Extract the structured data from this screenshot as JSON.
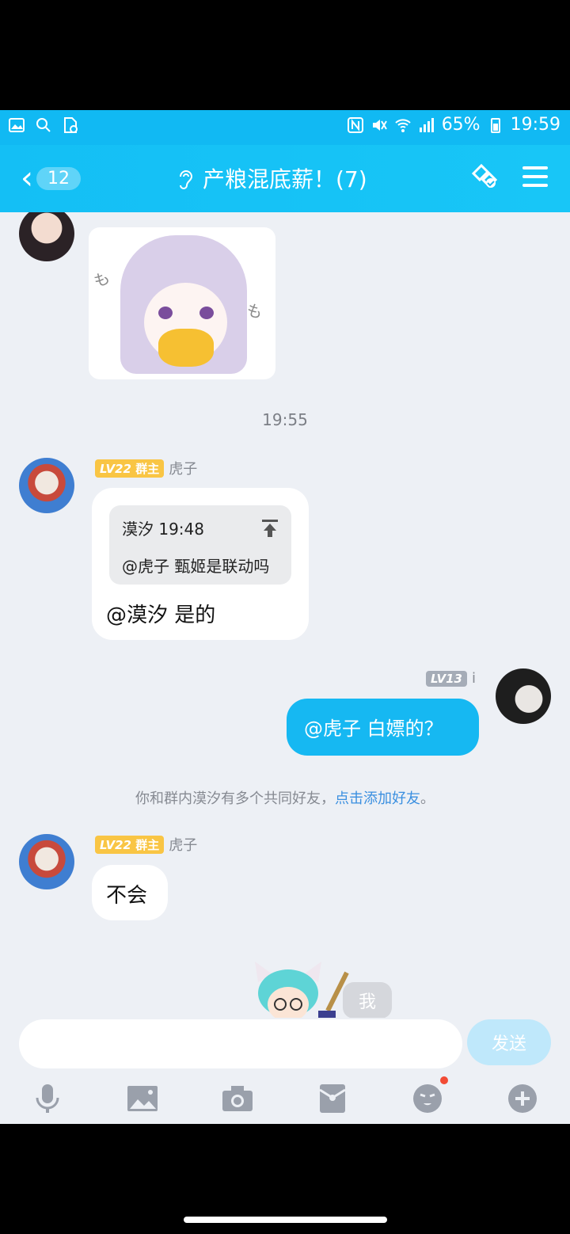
{
  "status_bar": {
    "battery": "65%",
    "time": "19:59"
  },
  "header": {
    "back_badge": "12",
    "title": "产粮混底薪！(7)"
  },
  "chat": {
    "timestamp": "19:55",
    "messages": [
      {
        "level": "LV22",
        "role": "群主",
        "sender": "虎子",
        "quote_header_name": "漠汐",
        "quote_header_time": "19:48",
        "quote_text": "@虎子 甄姬是联动吗",
        "text": "@漠汐 是的"
      },
      {
        "level": "LV13",
        "sender": "i",
        "text": "@虎子 白嫖的？"
      },
      {
        "level": "LV22",
        "role": "群主",
        "sender": "虎子",
        "text": "不会"
      }
    ],
    "notice_text": "你和群内漠汐有多个共同好友，",
    "notice_link": "点击添加好友",
    "notice_end": "。",
    "bottom_bubble": "我"
  },
  "input": {
    "send_label": "发送"
  },
  "icons": {
    "accent": "#16b8f2",
    "tools": [
      "microphone-icon",
      "image-icon",
      "camera-icon",
      "red-packet-icon",
      "emoji-icon",
      "plus-icon"
    ]
  }
}
